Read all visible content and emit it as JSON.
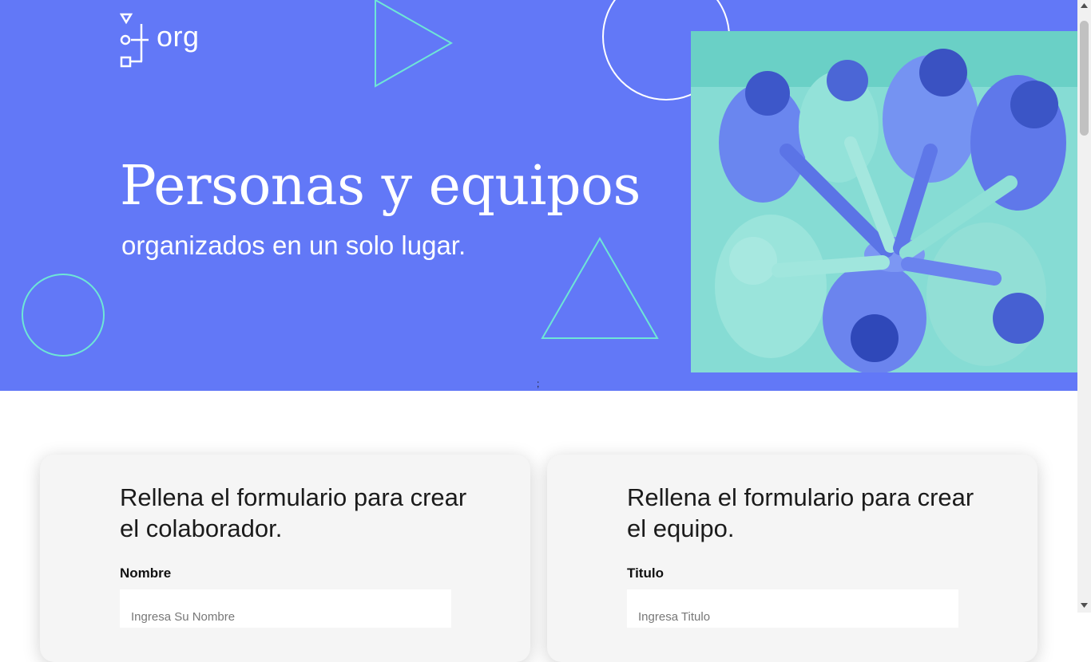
{
  "brand": {
    "logo_text": "org"
  },
  "hero": {
    "title": "Personas y equipos",
    "subtitle": "organizados en un solo lugar.",
    "stray_text": ";",
    "colors": {
      "background": "#6278f7",
      "accent": "#6ee6d6",
      "photo_tint": "#7fd9d2"
    },
    "photo_icon": "team-hands-photo"
  },
  "forms": {
    "collaborator": {
      "heading": "Rellena el formulario para crear el colaborador.",
      "field_label": "Nombre",
      "field_placeholder": "Ingresa Su Nombre"
    },
    "team": {
      "heading": "Rellena el formulario para crear el equipo.",
      "field_label": "Titulo",
      "field_placeholder": "Ingresa Titulo"
    }
  }
}
